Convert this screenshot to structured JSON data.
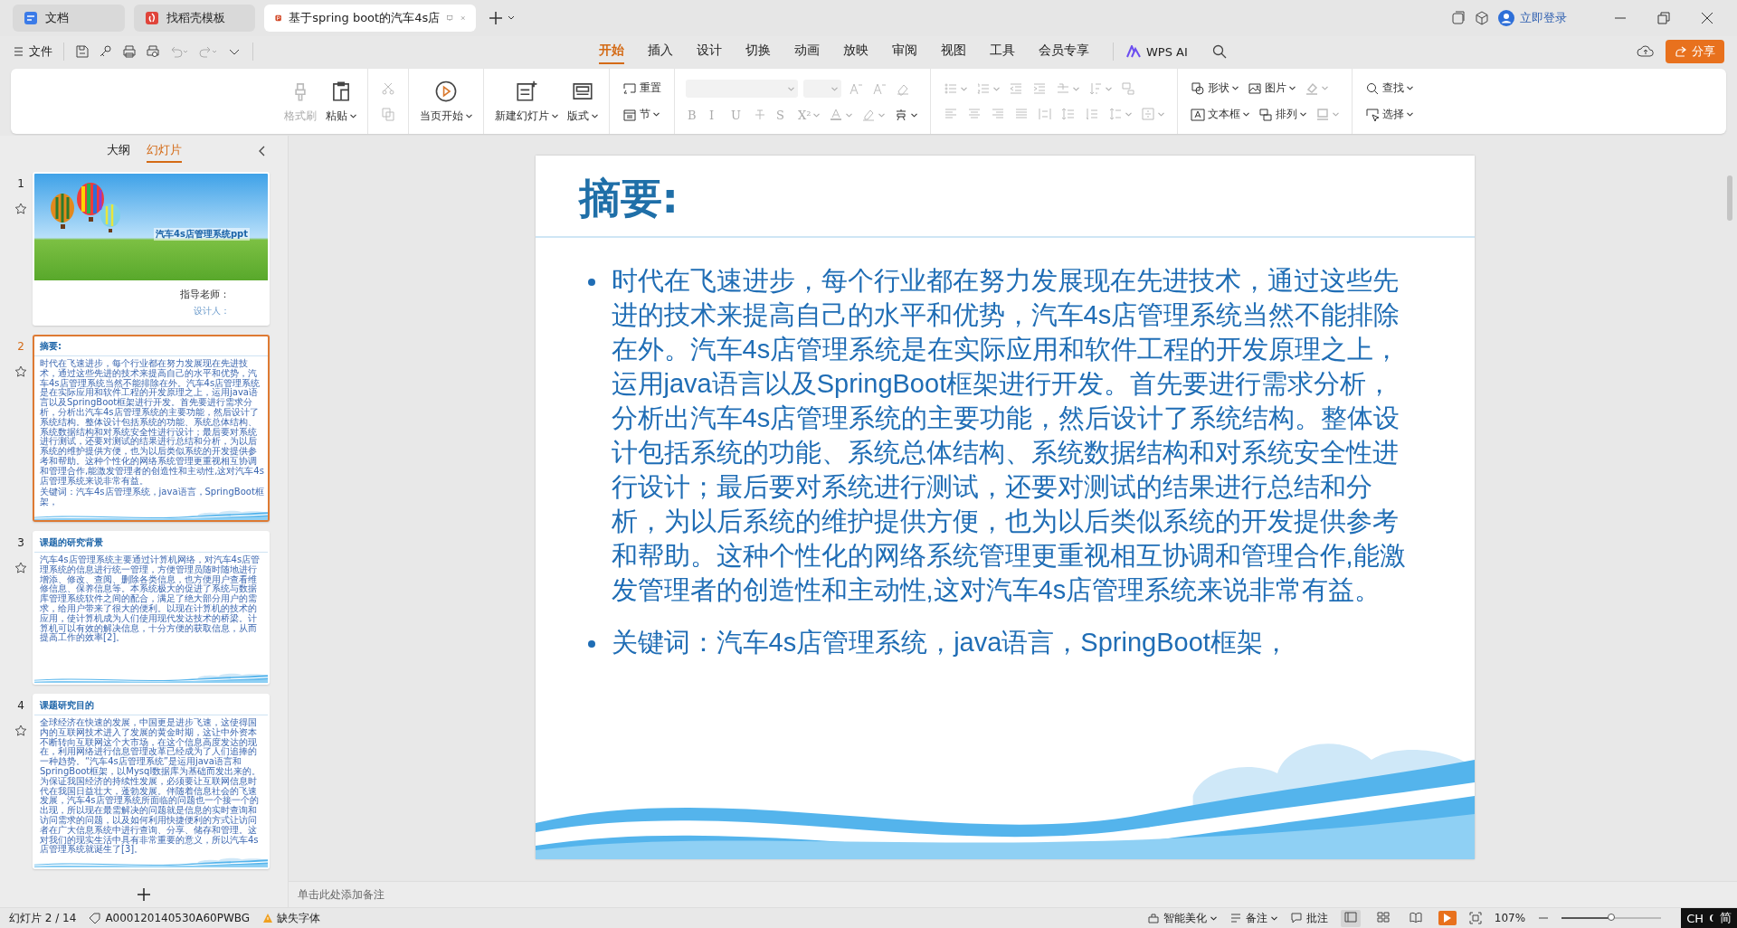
{
  "tabs": [
    {
      "label": "文档",
      "kind": "doc",
      "selected": false
    },
    {
      "label": "找稻壳模板",
      "kind": "docer",
      "selected": false
    },
    {
      "label": "基于spring boot的汽车4s店",
      "kind": "ppt",
      "selected": true
    }
  ],
  "account": {
    "login": "立即登录"
  },
  "menu": {
    "file": "文件",
    "tabs": [
      {
        "label": "开始",
        "selected": true
      },
      {
        "label": "插入",
        "selected": false
      },
      {
        "label": "设计",
        "selected": false
      },
      {
        "label": "切换",
        "selected": false
      },
      {
        "label": "动画",
        "selected": false
      },
      {
        "label": "放映",
        "selected": false
      },
      {
        "label": "审阅",
        "selected": false
      },
      {
        "label": "视图",
        "selected": false
      },
      {
        "label": "工具",
        "selected": false
      },
      {
        "label": "会员专享",
        "selected": false
      }
    ],
    "ai": "WPS AI",
    "share": "分享"
  },
  "ribbon": [
    {
      "items": [
        {
          "kind": "brush",
          "label": "格式刷",
          "disabled": true,
          "dropdown": false
        },
        {
          "kind": "paste",
          "label": "粘贴",
          "disabled": false,
          "dropdown": true
        }
      ]
    },
    {
      "rows": [
        [
          {
            "kind": "cut",
            "disabled": true,
            "dropdown": false
          }
        ],
        [
          {
            "kind": "copy",
            "disabled": true,
            "dropdown": false
          }
        ]
      ]
    },
    {
      "items": [
        {
          "kind": "play",
          "label": "当页开始",
          "disabled": false,
          "dropdown": true
        }
      ]
    },
    {
      "items": [
        {
          "kind": "newslide",
          "label": "新建幻灯片",
          "disabled": false,
          "dropdown": true
        },
        {
          "kind": "layout",
          "label": "版式",
          "disabled": false,
          "dropdown": true
        }
      ]
    },
    {
      "rows": [
        [
          {
            "kind": "reset",
            "label": "重置",
            "disabled": false,
            "dropdown": false
          }
        ],
        [
          {
            "kind": "section",
            "label": "节",
            "disabled": false,
            "dropdown": true
          }
        ]
      ]
    },
    {
      "rows": [
        [
          {
            "kind": "select",
            "disabled": true,
            "dropdown": true
          },
          {
            "kind": "selectsmall",
            "disabled": true,
            "dropdown": true
          },
          {
            "kind": "grow",
            "disabled": true,
            "dropdown": false
          },
          {
            "kind": "shrink",
            "disabled": true,
            "dropdown": false
          },
          {
            "kind": "eraser",
            "disabled": true,
            "dropdown": false
          }
        ],
        [
          {
            "kind": "glyph",
            "label": "B",
            "disabled": true,
            "dropdown": false
          },
          {
            "kind": "glyph",
            "label": "I",
            "disabled": true,
            "dropdown": false
          },
          {
            "kind": "glyph",
            "label": "U",
            "disabled": true,
            "dropdown": false
          },
          {
            "kind": "strike",
            "disabled": true,
            "dropdown": false
          },
          {
            "kind": "glyph",
            "label": "S",
            "disabled": true,
            "dropdown": false
          },
          {
            "kind": "glyph",
            "label": "X²",
            "disabled": true,
            "dropdown": true
          },
          {
            "kind": "fontcolor",
            "disabled": true,
            "dropdown": true
          },
          {
            "kind": "highlight",
            "disabled": true,
            "dropdown": true
          },
          {
            "kind": "phonetic",
            "disabled": false,
            "dropdown": true
          }
        ]
      ]
    },
    {
      "rows": [
        [
          {
            "kind": "bullets",
            "disabled": true,
            "dropdown": true
          },
          {
            "kind": "numbering",
            "disabled": true,
            "dropdown": true
          },
          {
            "kind": "outdent",
            "disabled": true,
            "dropdown": false
          },
          {
            "kind": "indent",
            "disabled": true,
            "dropdown": false
          },
          {
            "kind": "textdir",
            "disabled": true,
            "dropdown": true
          },
          {
            "kind": "sort",
            "disabled": true,
            "dropdown": true
          },
          {
            "kind": "convert",
            "disabled": true,
            "dropdown": false
          }
        ],
        [
          {
            "kind": "alignleft",
            "disabled": true,
            "dropdown": false
          },
          {
            "kind": "aligncenter",
            "disabled": true,
            "dropdown": false
          },
          {
            "kind": "alignright",
            "disabled": true,
            "dropdown": false
          },
          {
            "kind": "justify",
            "disabled": true,
            "dropdown": false
          },
          {
            "kind": "distribute",
            "disabled": true,
            "dropdown": false
          },
          {
            "kind": "linespace",
            "disabled": true,
            "dropdown": false
          },
          {
            "kind": "paraspace",
            "disabled": true,
            "dropdown": false
          },
          {
            "kind": "spacing",
            "disabled": true,
            "dropdown": true
          },
          {
            "kind": "valign",
            "disabled": true,
            "dropdown": true
          }
        ]
      ]
    },
    {
      "rows": [
        [
          {
            "kind": "shape",
            "label": "形状",
            "disabled": false,
            "dropdown": true
          },
          {
            "kind": "picture",
            "label": "图片",
            "disabled": false,
            "dropdown": true
          },
          {
            "kind": "fill",
            "disabled": true,
            "dropdown": true
          }
        ],
        [
          {
            "kind": "textbox",
            "label": "文本框",
            "disabled": false,
            "dropdown": true
          },
          {
            "kind": "arrange",
            "label": "排列",
            "disabled": false,
            "dropdown": true
          },
          {
            "kind": "outline",
            "disabled": true,
            "dropdown": true
          }
        ]
      ]
    },
    {
      "rows": [
        [
          {
            "kind": "find",
            "label": "查找",
            "disabled": false,
            "dropdown": true
          }
        ],
        [
          {
            "kind": "select-tool",
            "label": "选择",
            "disabled": false,
            "dropdown": true
          }
        ]
      ]
    }
  ],
  "sidebar": {
    "views": [
      {
        "label": "大纲",
        "selected": false
      },
      {
        "label": "幻灯片",
        "selected": true
      }
    ],
    "slides": [
      {
        "number": "1",
        "kind": "cover",
        "selected": false,
        "title": "汽车4s店管理系统ppt",
        "lines": [
          "指导老师：",
          "设计人："
        ]
      },
      {
        "number": "2",
        "kind": "content",
        "selected": true,
        "title": "摘要:",
        "bullets": [
          "时代在飞速进步，每个行业都在努力发展现在先进技术，通过这些先进的技术来提高自己的水平和优势，汽车4s店管理系统当然不能排除在外。汽车4s店管理系统是在实际应用和软件工程的开发原理之上，运用java语言以及SpringBoot框架进行开发。首先要进行需求分析，分析出汽车4s店管理系统的主要功能，然后设计了系统结构。整体设计包括系统的功能、系统总体结构、系统数据结构和对系统安全性进行设计；最后要对系统进行测试，还要对测试的结果进行总结和分析，为以后系统的维护提供方便，也为以后类似系统的开发提供参考和帮助。这种个性化的网络系统管理更重视相互协调和管理合作,能激发管理者的创造性和主动性,这对汽车4s店管理系统来说非常有益。",
          "关键词：汽车4s店管理系统，java语言，SpringBoot框架，"
        ]
      },
      {
        "number": "3",
        "kind": "content",
        "selected": false,
        "title": "课题的研究背景",
        "bullets": [
          "汽车4s店管理系统主要通过计算机网络，对汽车4s店管理系统的信息进行统一管理，方便管理员随时随地进行增添、修改、查阅、删除各类信息，也方便用户查看维修信息、保养信息等。本系统极大的促进了系统与数据库管理系统软件之间的配合，满足了绝大部分用户的需求，给用户带来了很大的便利。以现在计算机的技术的应用，使计算机成为人们使用现代发达技术的桥梁。计算机可以有效的解决信息，十分方便的获取信息，从而提高工作的效率[2]。"
        ]
      },
      {
        "number": "4",
        "kind": "content",
        "selected": false,
        "title": "课题研究目的",
        "bullets": [
          "全球经济在快速的发展，中国更是进步飞速，这使得国内的互联网技术进入了发展的黄金时期，这让中外资本不断转向互联网这个大市场，在这个信息高度发达的现在，利用网络进行信息管理改革已经成为了人们追捧的一种趋势。“汽车4s店管理系统”是运用java语言和SpringBoot框架，以Mysql数据库为基础而发出来的。为保证我国经济的持续性发展，必须要让互联网信息时代在我国日益壮大，蓬勃发展。伴随着信息社会的飞速发展，汽车4s店管理系统所面临的问题也一个接一个的出现，所以现在最需解决的问题就是信息的实时查询和访问需求的问题，以及如何利用快捷便利的方式让访问者在广大信息系统中进行查询、分享、储存和管理。这对我们的现实生活中具有非常重要的意义，所以汽车4s店管理系统就诞生了[3]。"
        ]
      }
    ]
  },
  "slide": {
    "title": "摘要:",
    "bullets": [
      "时代在飞速进步，每个行业都在努力发展现在先进技术，通过这些先进的技术来提高自己的水平和优势，汽车4s店管理系统当然不能排除在外。汽车4s店管理系统是在实际应用和软件工程的开发原理之上，运用java语言以及SpringBoot框架进行开发。首先要进行需求分析，分析出汽车4s店管理系统的主要功能，然后设计了系统结构。整体设计包括系统的功能、系统总体结构、系统数据结构和对系统安全性进行设计；最后要对系统进行测试，还要对测试的结果进行总结和分析，为以后系统的维护提供方便，也为以后类似系统的开发提供参考和帮助。这种个性化的网络系统管理更重视相互协调和管理合作,能激发管理者的创造性和主动性,这对汽车4s店管理系统来说非常有益。",
      "关键词：汽车4s店管理系统，java语言，SpringBoot框架，"
    ]
  },
  "notes": {
    "placeholder": "单击此处添加备注"
  },
  "status_bar": {
    "slide_counter": "幻灯片 2 / 14",
    "doc_id": "A000120140530A60PWBG",
    "missing_fonts": "缺失字体",
    "beautify": "智能美化",
    "notes": "备注",
    "comments": "批注",
    "views": [
      {
        "kind": "normal",
        "selected": true
      },
      {
        "kind": "sorter",
        "selected": false
      },
      {
        "kind": "reading",
        "selected": false
      }
    ],
    "zoom": "107%",
    "zoom_slider": {
      "level": 0.5
    }
  },
  "ime": {
    "language": "CH",
    "mode": "简"
  }
}
